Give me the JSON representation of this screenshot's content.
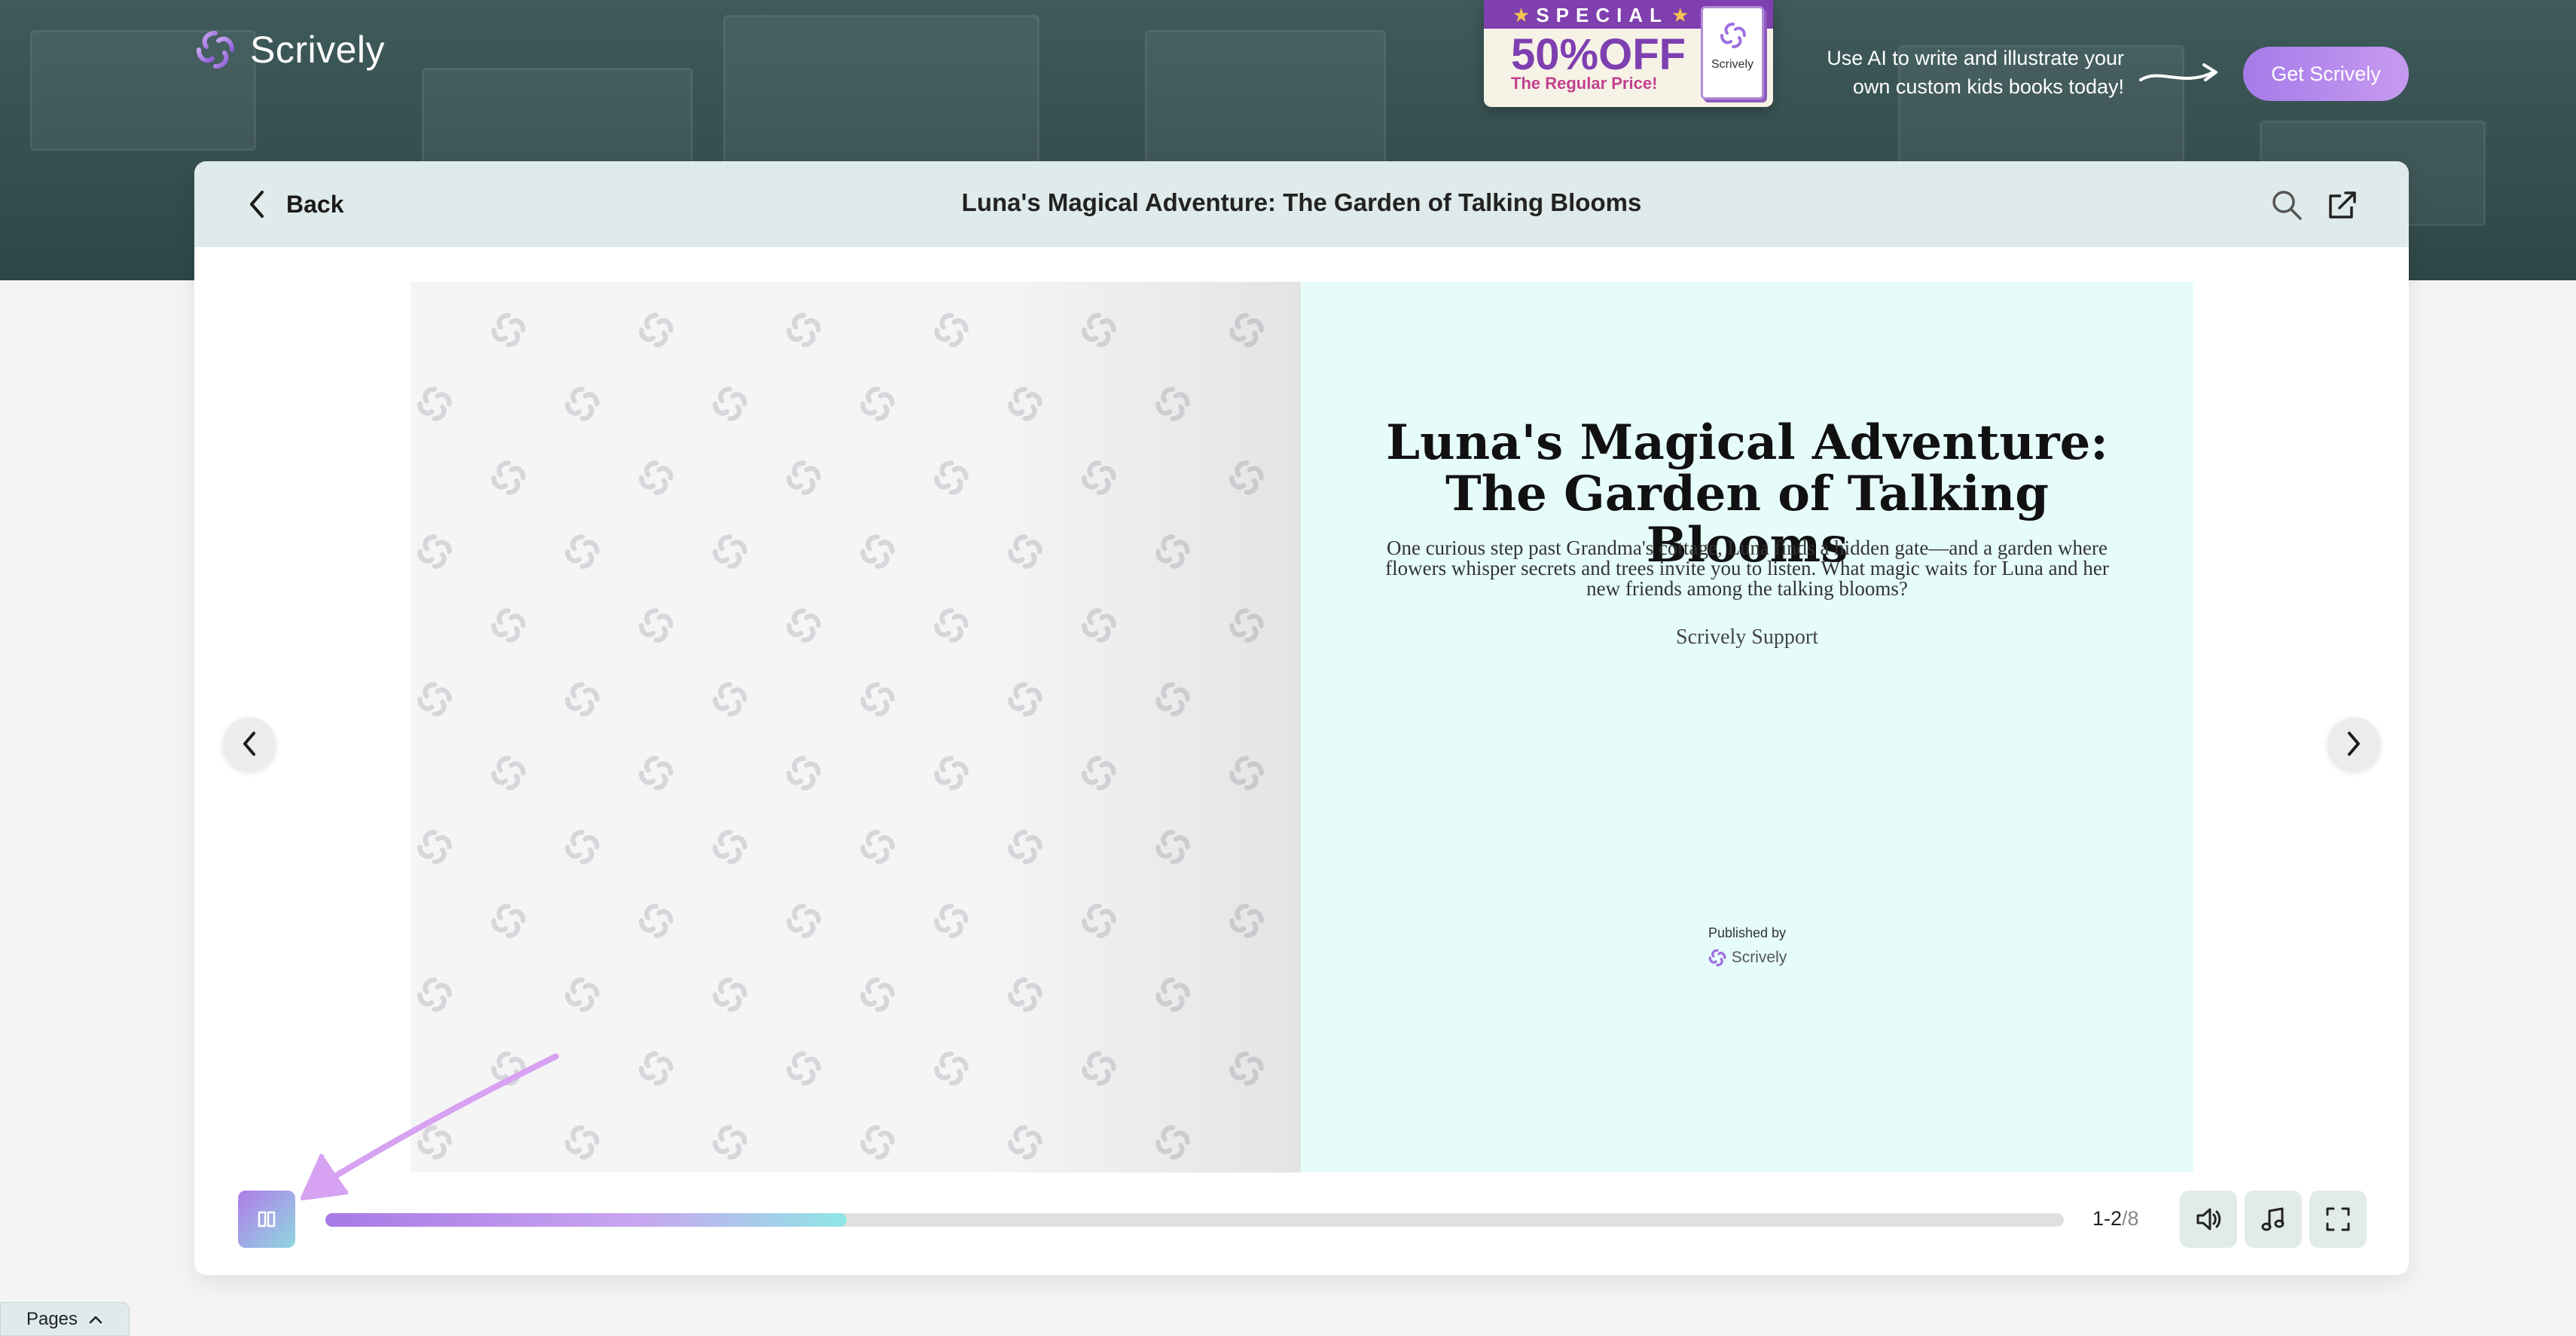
{
  "brand": {
    "name": "Scrively"
  },
  "promo": {
    "ribbon": "SPECIAL",
    "headline": "50%OFF",
    "subline": "The Regular Price!",
    "book_label": "Scrively"
  },
  "header_cta": {
    "text": "Use AI to write and illustrate your own custom kids books today!",
    "button": "Get Scrively"
  },
  "toolbar": {
    "back_label": "Back",
    "title": "Luna's Magical Adventure: The Garden of Talking Blooms",
    "search_icon": "search-icon",
    "share_icon": "external-link-icon"
  },
  "cover": {
    "title": "Luna's Magical Adventure: The Garden of Talking Blooms",
    "description": "One curious step past Grandma's cottage, Luna finds a hidden gate—and a garden where flowers whisper secrets and trees invite you to listen. What magic waits for Luna and her new friends among the talking blooms?",
    "author": "Scrively Support",
    "published_by": "Published by",
    "publisher": "Scrively"
  },
  "reader": {
    "progress": 0.3,
    "page_range": "1-2",
    "page_total": "/8"
  },
  "controls": {
    "thumbnails_icon": "pages-grid-icon",
    "narration_icon": "speaker-icon",
    "music_icon": "music-note-icon",
    "fullscreen_icon": "fullscreen-icon"
  },
  "footer": {
    "pages_tab": "Pages"
  },
  "colors": {
    "accent_purple": "#a67be9",
    "accent_teal": "#8fe6e6",
    "header_dark": "#2e4646",
    "cover_bg": "#e6fcfa"
  }
}
